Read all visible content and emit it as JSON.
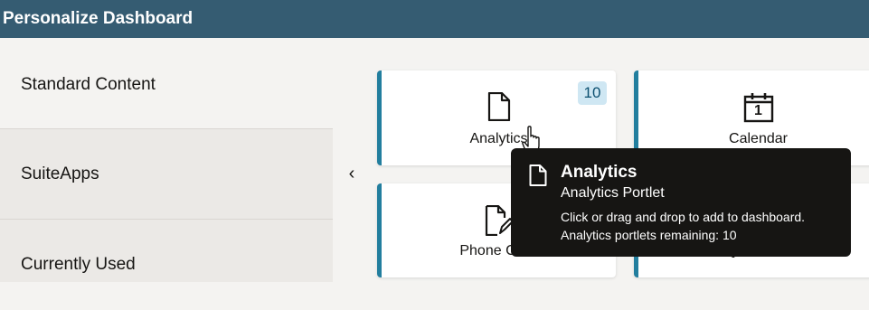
{
  "header": {
    "title": "Personalize Dashboard"
  },
  "sidebar": {
    "items": [
      {
        "label": "Standard Content"
      },
      {
        "label": "SuiteApps"
      },
      {
        "label": "Currently Used"
      }
    ],
    "collapse_glyph": "‹"
  },
  "tiles": [
    {
      "label": "Analytics",
      "icon": "document-icon",
      "badge": "10"
    },
    {
      "label": "Calendar",
      "icon": "calendar-icon",
      "icon_text": "1"
    },
    {
      "label": "Phone Calls",
      "icon": "phone-calls-icon"
    },
    {
      "label": "Quick Add",
      "icon": "quick-add-icon"
    }
  ],
  "tooltip": {
    "title": "Analytics",
    "subtitle": "Analytics Portlet",
    "description": "Click or drag and drop to add to dashboard.",
    "remaining": "Analytics portlets remaining: 10"
  },
  "colors": {
    "header_bg": "#355c72",
    "accent": "#227e9e",
    "badge_bg": "#cfe7f3",
    "tooltip_bg": "#161513"
  }
}
